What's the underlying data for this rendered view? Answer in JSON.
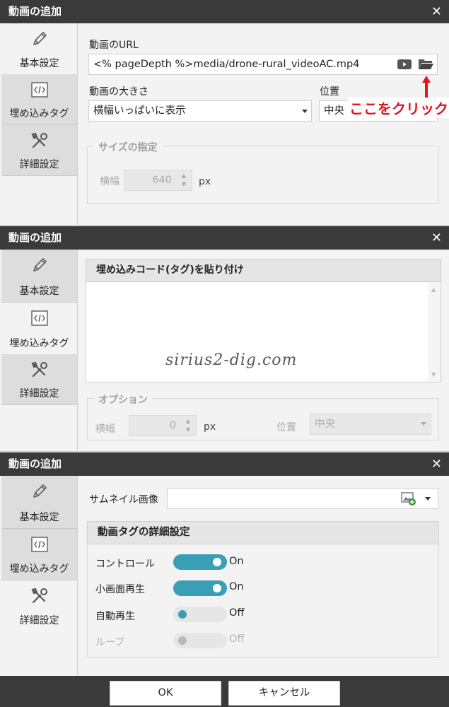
{
  "dialog1": {
    "title": "動画の追加",
    "close": "✕",
    "tabs": [
      "基本設定",
      "埋め込みタグ",
      "詳細設定"
    ],
    "url_label": "動画のURL",
    "url_value": "<% pageDepth %>media/drone-rural_videoAC.mp4",
    "size_label": "動画の大きさ",
    "size_value": "横幅いっぱいに表示",
    "position_label": "位置",
    "position_value": "中央",
    "annotation": "ここをクリック",
    "size_group_title": "サイズの指定",
    "width_label": "横幅",
    "width_value": "640",
    "unit": "px"
  },
  "dialog2": {
    "title": "動画の追加",
    "close": "✕",
    "tabs": [
      "基本設定",
      "埋め込みタグ",
      "詳細設定"
    ],
    "embed_header": "埋め込みコード(タグ)を貼り付け",
    "watermark": "sirius2-dig.com",
    "options_title": "オプション",
    "width_label": "横幅",
    "width_value": "0",
    "unit": "px",
    "position_label": "位置",
    "position_value": "中央"
  },
  "dialog3": {
    "title": "動画の追加",
    "close": "✕",
    "tabs": [
      "基本設定",
      "埋め込みタグ",
      "詳細設定"
    ],
    "thumbnail_label": "サムネイル画像",
    "detail_header": "動画タグの詳細設定",
    "toggles": [
      {
        "label": "コントロール",
        "state": "On",
        "on": true,
        "disabled": false
      },
      {
        "label": "小画面再生",
        "state": "On",
        "on": true,
        "disabled": false
      },
      {
        "label": "自動再生",
        "state": "Off",
        "on": false,
        "disabled": false
      },
      {
        "label": "ループ",
        "state": "Off",
        "on": false,
        "disabled": true
      }
    ],
    "ok_label": "OK",
    "cancel_label": "キャンセル"
  },
  "colors": {
    "titlebar": "#3a3a3a",
    "toggle_on": "#3a9fb4",
    "annotation": "#e0141e"
  },
  "icons": {
    "tab_basic": "pencil-icon",
    "tab_embed": "code-tag-icon",
    "tab_detail": "wrench-screwdriver-icon",
    "url_play": "youtube-play-icon",
    "url_folder": "folder-open-icon",
    "thumbnail": "image-add-icon"
  }
}
